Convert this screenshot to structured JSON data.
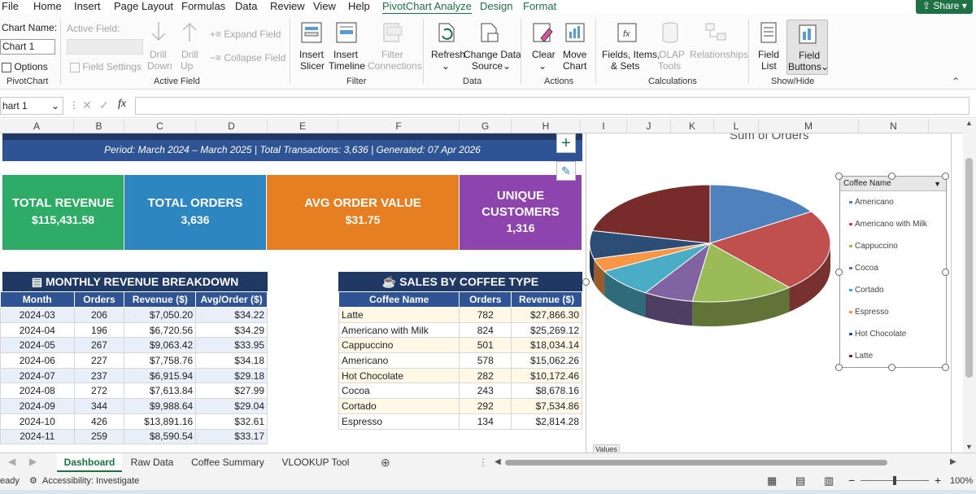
{
  "menu": {
    "items": [
      "File",
      "Home",
      "Insert",
      "Page Layout",
      "Formulas",
      "Data",
      "Review",
      "View",
      "Help",
      "PivotChart Analyze",
      "Design",
      "Format"
    ],
    "share_label": "Share"
  },
  "ribbon": {
    "chart_name_label": "Chart Name:",
    "chart_name_value": "Chart 1",
    "options_label": "Options",
    "pivotchart_group": "PivotChart",
    "active_field_label": "Active Field:",
    "field_settings": "Field Settings",
    "drill_down": [
      "Drill",
      "Down"
    ],
    "drill_up": [
      "Drill",
      "Up"
    ],
    "expand_field": "Expand Field",
    "collapse_field": "Collapse Field",
    "active_field_group": "Active Field",
    "insert_slicer": [
      "Insert",
      "Slicer"
    ],
    "insert_timeline": [
      "Insert",
      "Timeline"
    ],
    "filter_connections": [
      "Filter",
      "Connections"
    ],
    "filter_group": "Filter",
    "refresh": "Refresh",
    "change_data_source": [
      "Change Data",
      "Source"
    ],
    "data_group": "Data",
    "clear": "Clear",
    "move_chart": [
      "Move",
      "Chart"
    ],
    "actions_group": "Actions",
    "fields_items_sets": [
      "Fields, Items,",
      "& Sets"
    ],
    "olap_tools": [
      "OLAP",
      "Tools"
    ],
    "relationships": "Relationships",
    "calculations_group": "Calculations",
    "field_list": [
      "Field",
      "List"
    ],
    "field_buttons": [
      "Field",
      "Buttons"
    ],
    "showhide_group": "Show/Hide"
  },
  "formula_bar": {
    "name_box": "hart 1",
    "fx": "fx"
  },
  "columns": [
    "A",
    "B",
    "C",
    "D",
    "E",
    "F",
    "G",
    "H",
    "I",
    "J",
    "K",
    "L",
    "M",
    "N"
  ],
  "dashboard": {
    "banner": "Period: March 2024 – March 2025   |   Total Transactions: 3,636   |   Generated: 07 Apr 2026",
    "kpis": [
      {
        "title": "TOTAL REVENUE",
        "value": "$115,431.58",
        "color": "#2eac66"
      },
      {
        "title": "TOTAL ORDERS",
        "value": "3,636",
        "color": "#2e86c1"
      },
      {
        "title": "AVG ORDER VALUE",
        "value": "$31.75",
        "color": "#e67e22"
      },
      {
        "title": "UNIQUE CUSTOMERS",
        "value": "1,316",
        "color": "#8e44ad"
      }
    ],
    "monthly": {
      "title": "MONTHLY REVENUE BREAKDOWN",
      "headers": [
        "Month",
        "Orders",
        "Revenue ($)",
        "Avg/Order ($)"
      ],
      "rows": [
        [
          "2024-03",
          "206",
          "$7,050.20",
          "$34.22"
        ],
        [
          "2024-04",
          "196",
          "$6,720.56",
          "$34.29"
        ],
        [
          "2024-05",
          "267",
          "$9,063.42",
          "$33.95"
        ],
        [
          "2024-06",
          "227",
          "$7,758.76",
          "$34.18"
        ],
        [
          "2024-07",
          "237",
          "$6,915.94",
          "$29.18"
        ],
        [
          "2024-08",
          "272",
          "$7,613.84",
          "$27.99"
        ],
        [
          "2024-09",
          "344",
          "$9,988.64",
          "$29.04"
        ],
        [
          "2024-10",
          "426",
          "$13,891.16",
          "$32.61"
        ],
        [
          "2024-11",
          "259",
          "$8,590.54",
          "$33.17"
        ]
      ]
    },
    "coffee": {
      "title": "SALES BY COFFEE TYPE",
      "headers": [
        "Coffee Name",
        "Orders",
        "Revenue ($)"
      ],
      "rows": [
        [
          "Latte",
          "782",
          "$27,866.30"
        ],
        [
          "Americano with Milk",
          "824",
          "$25,269.12"
        ],
        [
          "Cappuccino",
          "501",
          "$18,034.14"
        ],
        [
          "Americano",
          "578",
          "$15,062.26"
        ],
        [
          "Hot Chocolate",
          "282",
          "$10,172.46"
        ],
        [
          "Cocoa",
          "243",
          "$8,678.16"
        ],
        [
          "Cortado",
          "292",
          "$7,534.86"
        ],
        [
          "Espresso",
          "134",
          "$2,814.28"
        ]
      ]
    }
  },
  "chart_data": {
    "type": "pie",
    "title": "Sum of Orders",
    "field_button": "Coffee Name",
    "values_button": "Values",
    "categories": [
      "Americano",
      "Americano with Milk",
      "Cappuccino",
      "Cocoa",
      "Cortado",
      "Espresso",
      "Hot Chocolate",
      "Latte"
    ],
    "values": [
      578,
      824,
      501,
      243,
      292,
      134,
      282,
      782
    ],
    "colors": [
      "#4f81bd",
      "#c0504d",
      "#9bbb59",
      "#8064a2",
      "#4bacc6",
      "#f79646",
      "#2c4d75",
      "#772c2a"
    ]
  },
  "tabs": [
    "Dashboard",
    "Raw Data",
    "Coffee Summary",
    "VLOOKUP Tool"
  ],
  "status": {
    "ready": "eady",
    "accessibility": "Accessibility: Investigate",
    "zoom": "100%"
  }
}
